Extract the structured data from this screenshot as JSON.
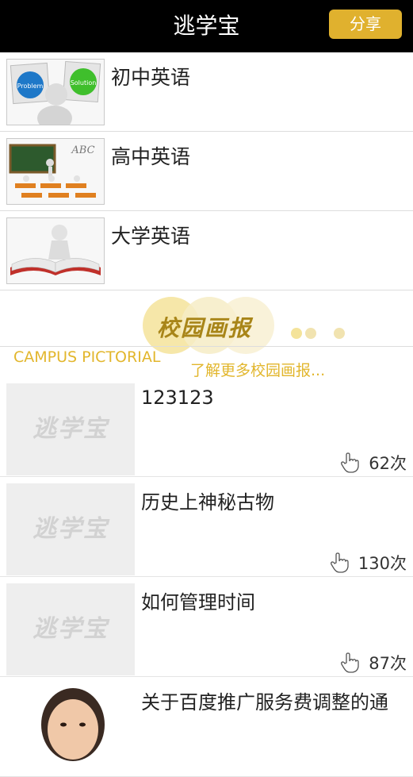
{
  "header": {
    "title": "逃学宝",
    "share_label": "分享"
  },
  "courses": [
    {
      "label": "初中英语",
      "thumb_icon": "problem-solution-illustration-icon",
      "thumb_text": [
        "Problem",
        "Solution"
      ]
    },
    {
      "label": "高中英语",
      "thumb_icon": "classroom-illustration-icon",
      "thumb_text": [
        "ABC"
      ]
    },
    {
      "label": "大学英语",
      "thumb_icon": "book-figure-illustration-icon",
      "thumb_text": []
    }
  ],
  "banner": {
    "logo_text": "校园画报",
    "en_text": "CAMPUS PICTORIAL",
    "more_text": "了解更多校园画报...",
    "accent_color": "#e2b62c"
  },
  "placeholder_text": "逃学宝",
  "articles": [
    {
      "title": "123123",
      "views": "62次",
      "thumb": "placeholder"
    },
    {
      "title": "历史上神秘古物",
      "views": "130次",
      "thumb": "placeholder"
    },
    {
      "title": "如何管理时间",
      "views": "87次",
      "thumb": "placeholder"
    },
    {
      "title": "关于百度推广服务费调整的通",
      "views": "",
      "thumb": "person-photo"
    }
  ],
  "colors": {
    "topbar": "#000000",
    "share_button": "#e0b12e"
  }
}
